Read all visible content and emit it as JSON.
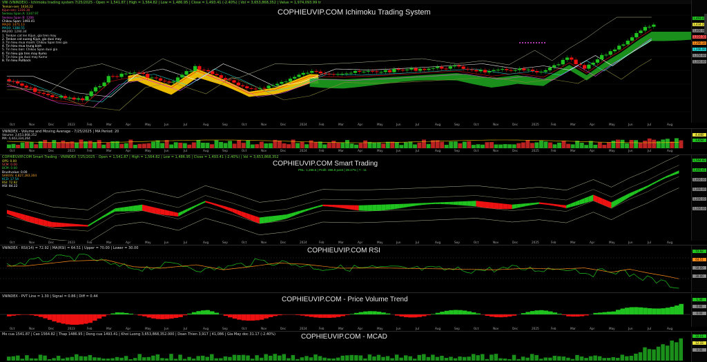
{
  "app": {
    "symbol": "VNINDEX (Weekly)"
  },
  "colors": {
    "green": "#1fc21f",
    "red": "#e11",
    "yellow": "#f5c400",
    "magenta": "#e04fe0",
    "orange": "#ff8c1a",
    "olive": "#8c8c3c",
    "cyan": "#28d7d7"
  },
  "pane1": {
    "title": "COPHIEUVIP.COM Ichimoku Trading System",
    "header": "VNI (VNINDEX) - Ichimoku trading system 7/25/2025 - Open = 1,541.87 | High = 1,564.82 | Low = 1,486.95 | Close = 1,493.41 (-2.40%) | Vol = 3,653,868,352 | Value = 1,974,093.99 tr",
    "info_lines": [
      "Tenkan-sen: 1434.22",
      "Kijun-sen: 1316.30",
      "Senkou Span A: 1347.97",
      "Senkou Span B: 1206",
      "Chikou Span: 1493.41",
      "MA20: 1471.13",
      "MA50: 1388.55",
      "MA200: 1290.34",
      "1. Tenkan cat len Kijun, gia tren may",
      "2. Tenkan cat xuong Kijun, gia duoi may",
      "3. Tin hieu mua manh: Chikou Span tren gia",
      "4. Tin hieu mua trung binh",
      "5. Tin hieu ban: Chikou Span duoi gia",
      "6. Tin hieu gia tren may Kumo",
      "7. Tin hieu gia duoi may Kumo",
      "8. Tin hieu Pullback"
    ],
    "price_tags": [
      "1,493.41",
      "1,434.22",
      "1,400.00",
      "1,316.30",
      "1,290.34",
      "1,206.00",
      "1,150.00",
      "1,100.00"
    ]
  },
  "pane2": {
    "header": "VNINDEX - Volume and Moving Average - 7/25/2025 | MA Period: 20",
    "info_lines": [
      "Volume: 3,653,868,352",
      "MA: 4,443,334,264"
    ],
    "tags": [
      "4.44B",
      "3.65B"
    ]
  },
  "pane3": {
    "title": "COPHIEUVIP.COM Smart Trading",
    "header": "COPHIEUVIP.COM Smart Trading - VNINDEX 7/25/2025 - Open = 1,541.87 | High = 1,564.82 | Low = 1,486.95 | Close = 1,493.41 (-2.40%) | Vol = 3,653,868,352",
    "subtitle": "PNL: 1,286.6 | Profit: 396.8 point | 39.17% | T : 11",
    "info_lines": [
      "OPS: 0.00",
      "SCM: 0.00",
      "BCM: 0.00",
      "Brushvalue: 0.00",
      "SAR/VS: 4,827,283,304",
      "KCD: 17.54",
      "RSI: 72.92",
      "HSI: 84.22"
    ],
    "tags": [
      "1,564.82",
      "1,493.41",
      "1,400.00",
      "1,300.00",
      "1,200.00",
      "1,100.00"
    ]
  },
  "pane4": {
    "title": "COPHIEUVIP.COM RSI",
    "header": "VNINDEX - RSI(14) = 72.92 | MA(RSI) = 64.51 | Upper = 70.00 | Lower = 30.00",
    "tags": [
      "72.92",
      "64.51",
      "50.00",
      "30.00"
    ]
  },
  "pane5": {
    "title": "COPHIEUVIP.COM - Price Volume Trend",
    "header": "VNINDEX - PVT Line = 1.30 | Signal = 0.86 | Diff = 0.44",
    "tags": [
      "1.30",
      "0.86",
      "0.00"
    ]
  },
  "pane6": {
    "title": "COPHIEUVIP.COM - MCAD",
    "header": "Mo cua 1541.87 | Cao 1564.82 | Thap 1486.95 | Dong cua 1493.41 | Khoi Luong 3,653,868,352.000 | Doan Thien 3,917 | 41,086 | Gia May doc 31.17 (-2.40%)",
    "tags": [
      "32.11",
      "12.33",
      "0.00"
    ]
  },
  "date_axis": [
    "Oct",
    "Nov",
    "Dec",
    "2023",
    "Feb",
    "Mar",
    "Apr",
    "May",
    "Jun",
    "Jul",
    "Aug",
    "Sep",
    "Oct",
    "Nov",
    "Dec",
    "2024",
    "Feb",
    "Mar",
    "Apr",
    "May",
    "Jun",
    "Jul",
    "Aug",
    "Sep",
    "Oct",
    "Nov",
    "Dec",
    "2025",
    "Feb",
    "Mar",
    "Apr",
    "May",
    "Jun",
    "Jul",
    "Aug"
  ]
}
